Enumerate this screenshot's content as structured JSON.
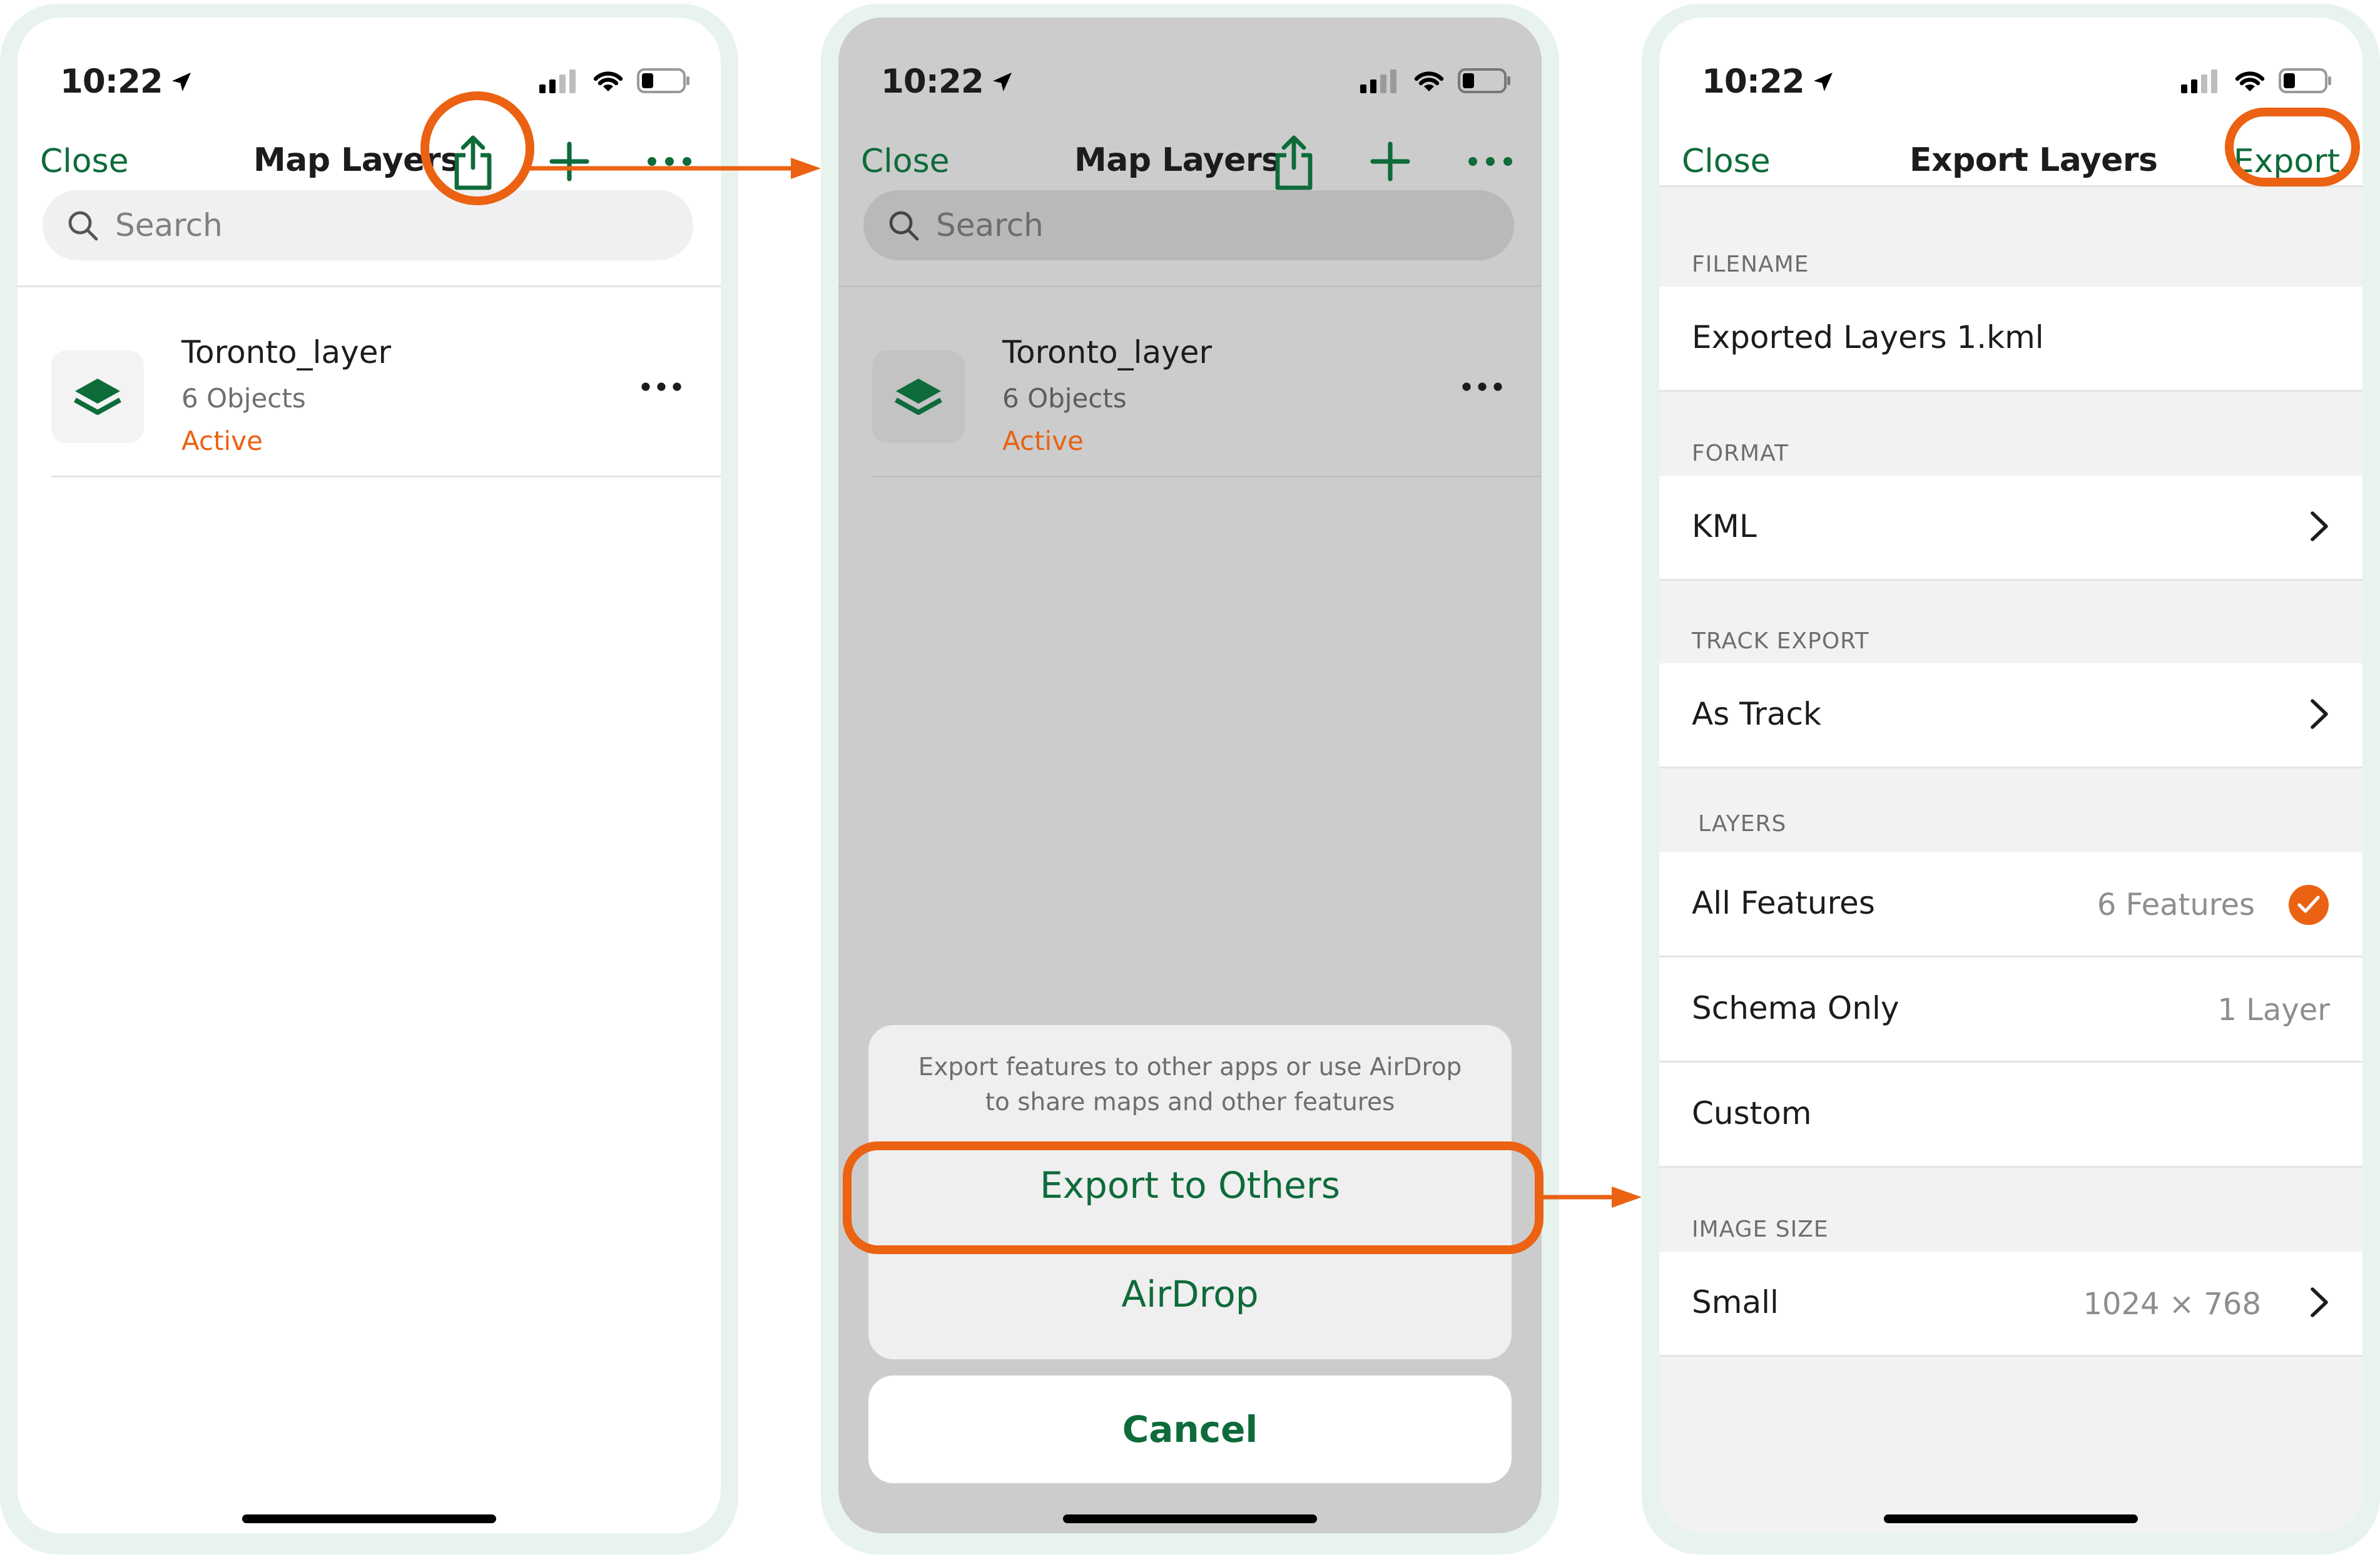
{
  "status_bar": {
    "time": "10:22"
  },
  "screen1": {
    "nav": {
      "close": "Close",
      "title": "Map Layers"
    },
    "search": {
      "placeholder": "Search"
    },
    "layer": {
      "name": "Toronto_layer",
      "count": "6 Objects",
      "status": "Active"
    }
  },
  "screen2": {
    "nav": {
      "close": "Close",
      "title": "Map Layers"
    },
    "search": {
      "placeholder": "Search"
    },
    "layer": {
      "name": "Toronto_layer",
      "count": "6 Objects",
      "status": "Active"
    },
    "sheet": {
      "message": "Export features to other apps or use AirDrop to share maps and other features",
      "export_others": "Export to Others",
      "airdrop": "AirDrop",
      "cancel": "Cancel"
    }
  },
  "screen3": {
    "nav": {
      "close": "Close",
      "title": "Export Layers",
      "export": "Export"
    },
    "filename": {
      "label": "FILENAME",
      "value": "Exported Layers 1.kml"
    },
    "format": {
      "label": "FORMAT",
      "value": "KML"
    },
    "track_export": {
      "label": "TRACK EXPORT",
      "value": "As Track"
    },
    "layers": {
      "label": "LAYERS",
      "all_features": {
        "label": "All Features",
        "value": "6 Features"
      },
      "schema_only": {
        "label": "Schema Only",
        "value": "1 Layer"
      },
      "custom": {
        "label": "Custom"
      }
    },
    "image_size": {
      "label": "IMAGE SIZE",
      "value": "Small",
      "dimensions": "1024 × 768"
    }
  },
  "colors": {
    "accent": "#0e6b3a",
    "highlight": "#ea6212",
    "frame": "#e8f3ee"
  }
}
